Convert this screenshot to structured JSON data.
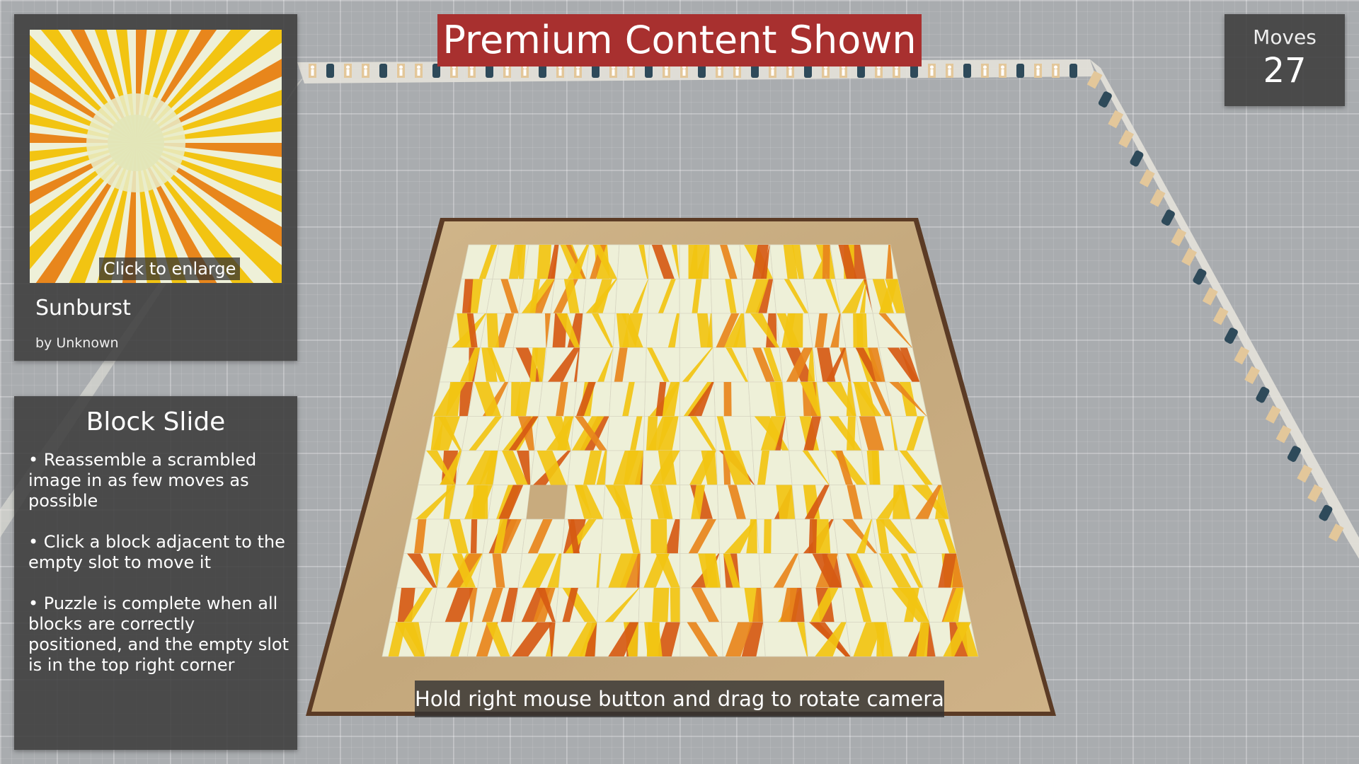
{
  "banner": {
    "text": "Premium Content Shown"
  },
  "preview": {
    "enlarge_label": "Click to enlarge",
    "title": "Sunburst",
    "author": "by Unknown"
  },
  "game": {
    "title": "Block Slide",
    "instructions": [
      "• Reassemble a scrambled image in as few moves as possible",
      "• Click a block adjacent to the empty slot to move it",
      "• Puzzle is complete when all blocks are correctly positioned, and the empty slot is in the top right corner"
    ]
  },
  "moves": {
    "label": "Moves",
    "value": "27"
  },
  "hint": {
    "text": "Hold right mouse button and drag to rotate camera"
  },
  "board": {
    "rows": 12,
    "cols": 14,
    "empty_slot": {
      "row": 7,
      "col": 3
    },
    "icons": [
      "wall-figure-icon",
      "wall-phone-icon"
    ]
  },
  "colors": {
    "banner": "#a8302f",
    "panel": "#3c3c3c",
    "ray_yellow": "#f2c412",
    "ray_orange": "#e8861c",
    "ray_deep": "#d65a14",
    "tile_base": "#eef0d8",
    "wood": "#c9ad82",
    "wood_edge": "#5b3b25",
    "floor": "#a9acaf"
  }
}
